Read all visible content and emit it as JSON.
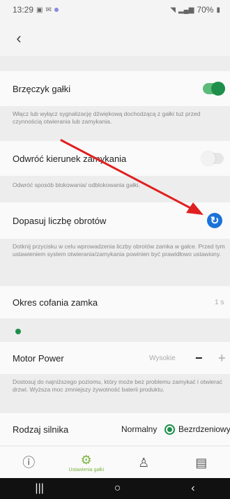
{
  "status_bar": {
    "time": "13:29",
    "battery": "70%"
  },
  "header": {
    "back_icon": "chevron-left-icon"
  },
  "settings": {
    "buzzer": {
      "label": "Brzęczyk gałki",
      "description": "Włącz lub wyłącz sygnalizację dźwiękową dochodzącą z gałki tuż przed czynnością otwierania lub zamykania.",
      "enabled": true
    },
    "reverse": {
      "label": "Odwróć kierunek zamykania",
      "description": "Odwróć sposób blokowania/ odblokowania gałki.",
      "enabled": false
    },
    "rotations": {
      "label": "Dopasuj liczbę obrotów",
      "description": "Dotknij przycisku w celu wprowadzenia liczby obrotów zamka w gałce. Przed tym ustawieniem system otwierania/zamykania powinien być prawidłowo ustawiony."
    },
    "retract": {
      "label": "Okres cofania zamka",
      "value": "1 s"
    },
    "motor_power": {
      "label": "Motor Power",
      "value": "Wysokie",
      "minus": "−",
      "plus": "+",
      "description": "Dostosuj do najniższego poziomu, który może bez problemu zamykać i otwierać drzwi. Wyższa moc zmniejszy żywotność baterii produktu."
    },
    "motor_type": {
      "label": "Rodzaj silnika",
      "option_normal": "Normalny",
      "option_coreless": "Bezrdzeniowy",
      "selected": "Bezrdzeniowy"
    }
  },
  "bottom_nav": {
    "items": [
      {
        "icon": "info-icon",
        "label": ""
      },
      {
        "icon": "gear-icon",
        "label": "Ustawienia gałki"
      },
      {
        "icon": "user-icon",
        "label": ""
      },
      {
        "icon": "clipboard-icon",
        "label": ""
      }
    ]
  },
  "colors": {
    "accent_green": "#1d8f4b",
    "refresh_blue": "#1a73d9",
    "annotation_red": "#e02020"
  }
}
